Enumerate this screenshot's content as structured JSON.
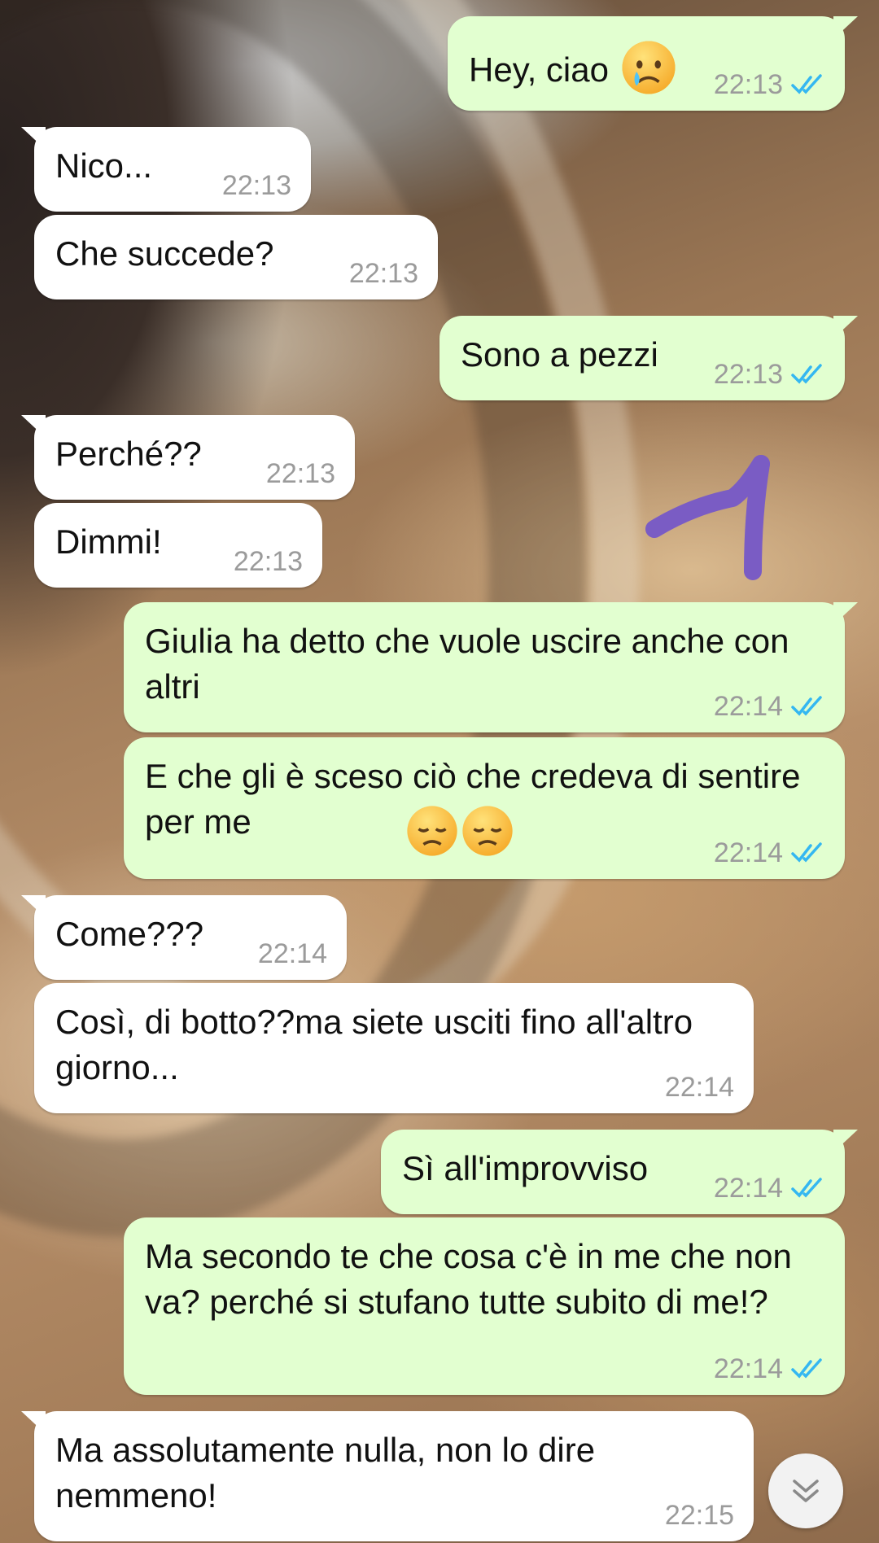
{
  "messages": [
    {
      "dir": "out",
      "text": "Hey, ciao",
      "emoji": "crying-face",
      "time": "22:13",
      "read": true
    },
    {
      "dir": "in",
      "text": "Nico...",
      "time": "22:13"
    },
    {
      "dir": "in",
      "text": "Che succede?",
      "time": "22:13"
    },
    {
      "dir": "out",
      "text": "Sono a pezzi",
      "time": "22:13",
      "read": true
    },
    {
      "dir": "in",
      "text": "Perché??",
      "time": "22:13"
    },
    {
      "dir": "in",
      "text": "Dimmi!",
      "time": "22:13"
    },
    {
      "dir": "out",
      "text": "Giulia ha detto che vuole uscire anche con altri",
      "time": "22:14",
      "read": true
    },
    {
      "dir": "out",
      "text": "E che gli è sceso ciò che credeva di sentire per me",
      "emoji": "disappointed-face x2",
      "time": "22:14",
      "read": true
    },
    {
      "dir": "in",
      "text": "Come???",
      "time": "22:14"
    },
    {
      "dir": "in",
      "text": "Così, di botto??ma siete usciti fino all'altro giorno...",
      "time": "22:14"
    },
    {
      "dir": "out",
      "text": "Sì all'improvviso",
      "time": "22:14",
      "read": true
    },
    {
      "dir": "out",
      "text": "Ma secondo te che cosa c'è in me che non va? perché si stufano tutte subito di me!?",
      "time": "22:14",
      "read": true
    },
    {
      "dir": "in",
      "text": "Ma assolutamente nulla, non lo dire nemmeno!",
      "time": "22:15"
    }
  ],
  "colors": {
    "incoming_bubble": "#ffffff",
    "outgoing_bubble": "#e2ffd0",
    "read_ticks": "#34b7f1",
    "time_text": "#9b9b9b",
    "annotation_stroke": "#7a5cc4"
  },
  "icons": {
    "read_receipt": "double-check-icon",
    "scroll_down": "double-chevron-down-icon"
  }
}
